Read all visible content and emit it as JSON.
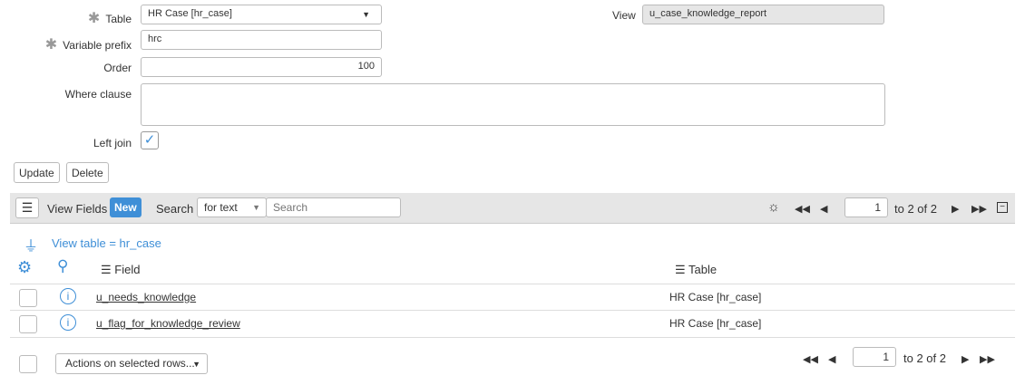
{
  "form": {
    "table_label": "Table",
    "table_value": "HR Case [hr_case]",
    "view_label": "View",
    "view_value": "u_case_knowledge_report",
    "prefix_label": "Variable prefix",
    "prefix_value": "hrc",
    "order_label": "Order",
    "order_value": "100",
    "where_label": "Where clause",
    "where_value": "",
    "leftjoin_label": "Left join",
    "leftjoin_checked": true,
    "update": "Update",
    "delete": "Delete"
  },
  "list": {
    "title": "View Fields",
    "new": "New",
    "search_label": "Search",
    "search_option": "for text",
    "search_placeholder": "Search",
    "page": "1",
    "range": "to 2 of 2",
    "filter": "View table = hr_case",
    "columns": [
      "Field",
      "Table"
    ],
    "rows": [
      {
        "field": "u_needs_knowledge",
        "table": "HR Case [hr_case]"
      },
      {
        "field": "u_flag_for_knowledge_review",
        "table": "HR Case [hr_case]"
      }
    ],
    "actions": "Actions on selected rows..."
  }
}
